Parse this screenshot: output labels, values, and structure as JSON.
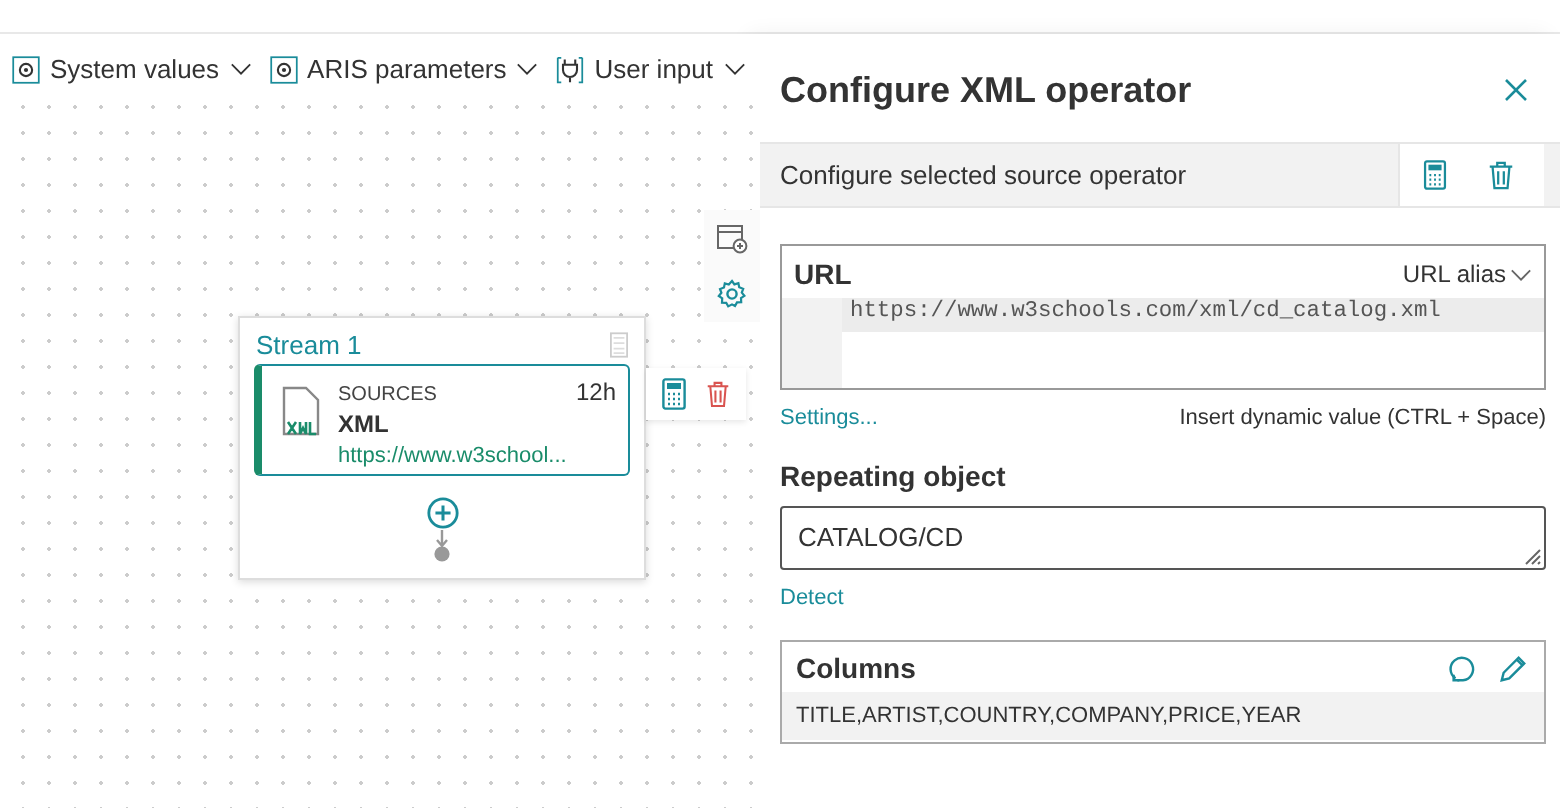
{
  "toolbar": [
    {
      "label": "System values",
      "kind": "parameter"
    },
    {
      "label": "ARIS parameters",
      "kind": "parameter"
    },
    {
      "label": "User input",
      "kind": "input"
    }
  ],
  "stream": {
    "title": "Stream 1",
    "operator": {
      "category": "SOURCES",
      "name": "XML",
      "schedule": "12h",
      "url": "https://www.w3school..."
    }
  },
  "panel": {
    "title": "Configure XML operator",
    "subtitle": "Configure selected source operator",
    "url": {
      "label": "URL",
      "alias": "URL alias",
      "value": "https://www.w3schools.com/xml/cd_catalog.xml"
    },
    "settings_link": "Settings...",
    "hint": "Insert dynamic value (CTRL + Space)",
    "repeating": {
      "label": "Repeating object",
      "value": "CATALOG/CD"
    },
    "detect_link": "Detect",
    "columns": {
      "label": "Columns",
      "value": "TITLE,ARTIST,COUNTRY,COMPANY,PRICE,YEAR"
    }
  }
}
